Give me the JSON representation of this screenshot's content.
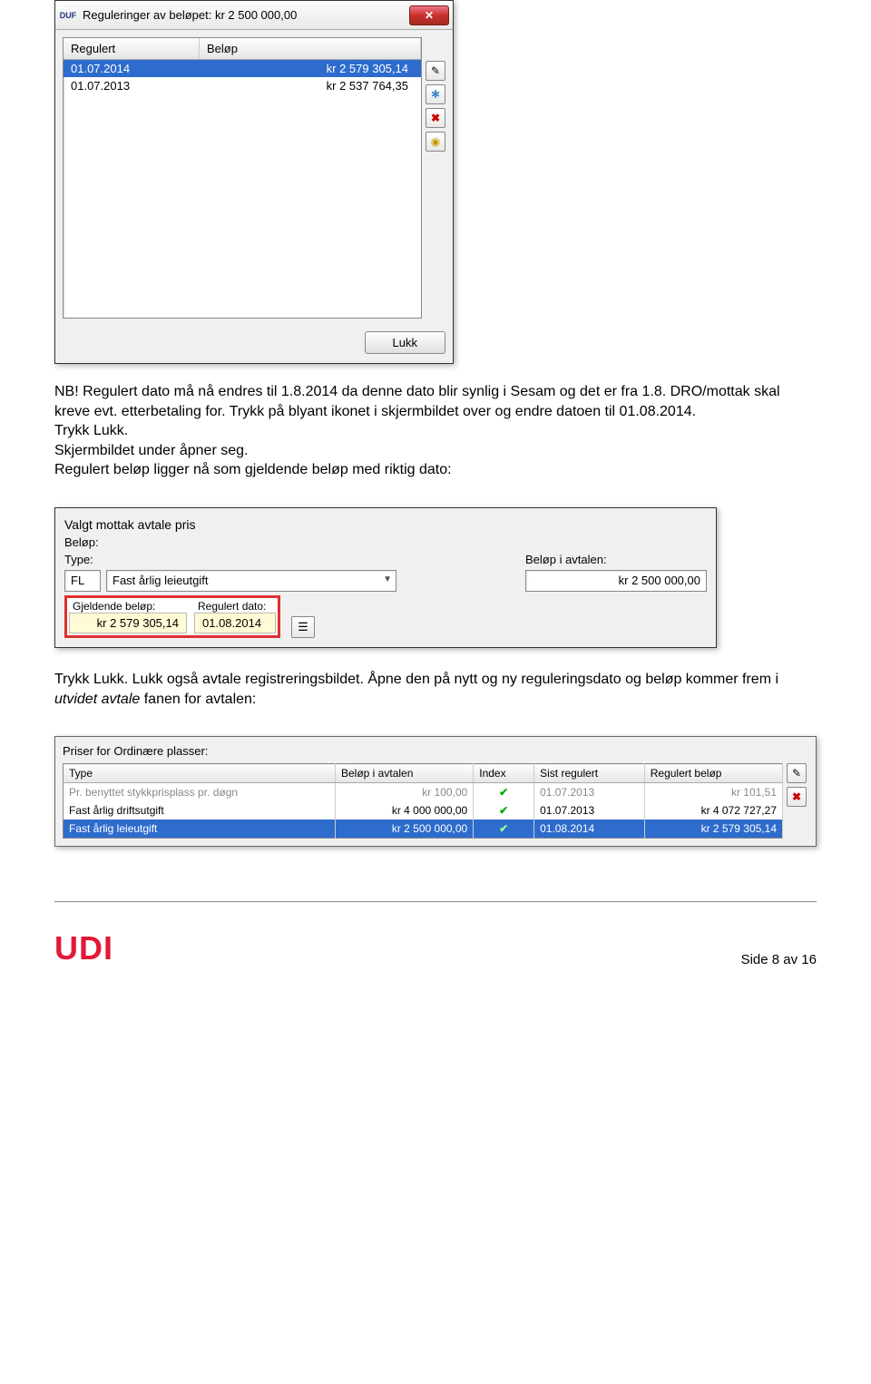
{
  "dialog1": {
    "title": "Reguleringer av beløpet: kr 2 500 000,00",
    "cols": {
      "regulert": "Regulert",
      "belop": "Beløp"
    },
    "rows": [
      {
        "date": "01.07.2014",
        "amount": "kr 2 579 305,14",
        "selected": true
      },
      {
        "date": "01.07.2013",
        "amount": "kr 2 537 764,35",
        "selected": false
      }
    ],
    "close": "Lukk"
  },
  "para1_a": "NB! Regulert dato må nå endres til 1.8.2014 da denne dato blir synlig i Sesam og det er fra 1.8. DRO/mottak skal kreve evt. etterbetaling for. Trykk på blyant ikonet i skjermbildet over og endre datoen til 01.08.2014.",
  "para2": "Trykk Lukk.",
  "para3": "Skjermbildet under åpner seg.",
  "para4": "Regulert beløp ligger nå som gjeldende beløp med riktig dato:",
  "dialog2": {
    "header": "Valgt mottak avtale pris",
    "belop_label": "Beløp:",
    "type_label": "Type:",
    "avtale_label": "Beløp i avtalen:",
    "fl": "FL",
    "type_value": "Fast årlig leieutgift",
    "avtale_value": "kr 2 500 000,00",
    "gjeldende_label": "Gjeldende beløp:",
    "regulert_label": "Regulert dato:",
    "gjeldende_value": "kr 2 579 305,14",
    "regulert_value": "01.08.2014"
  },
  "para5_a": "Trykk Lukk. Lukk også avtale registreringsbildet. Åpne den på nytt og ny reguleringsdato og beløp kommer frem i ",
  "para5_em": "utvidet avtale",
  "para5_b": " fanen for avtalen:",
  "dialog3": {
    "title": "Priser for Ordinære plasser:",
    "headers": {
      "type": "Type",
      "belop": "Beløp i avtalen",
      "index": "Index",
      "sist": "Sist regulert",
      "reg": "Regulert beløp"
    },
    "rows": [
      {
        "type": "Pr. benyttet stykkprisplass pr. døgn",
        "belop": "kr 100,00",
        "sist": "01.07.2013",
        "reg": "kr 101,51",
        "state": "grey"
      },
      {
        "type": "Fast årlig driftsutgift",
        "belop": "kr 4 000 000,00",
        "sist": "01.07.2013",
        "reg": "kr 4 072 727,27",
        "state": ""
      },
      {
        "type": "Fast årlig leieutgift",
        "belop": "kr 2 500 000,00",
        "sist": "01.08.2014",
        "reg": "kr 2 579 305,14",
        "state": "sel"
      }
    ]
  },
  "footer": {
    "logo": "UDI",
    "page": "Side 8 av 16"
  }
}
